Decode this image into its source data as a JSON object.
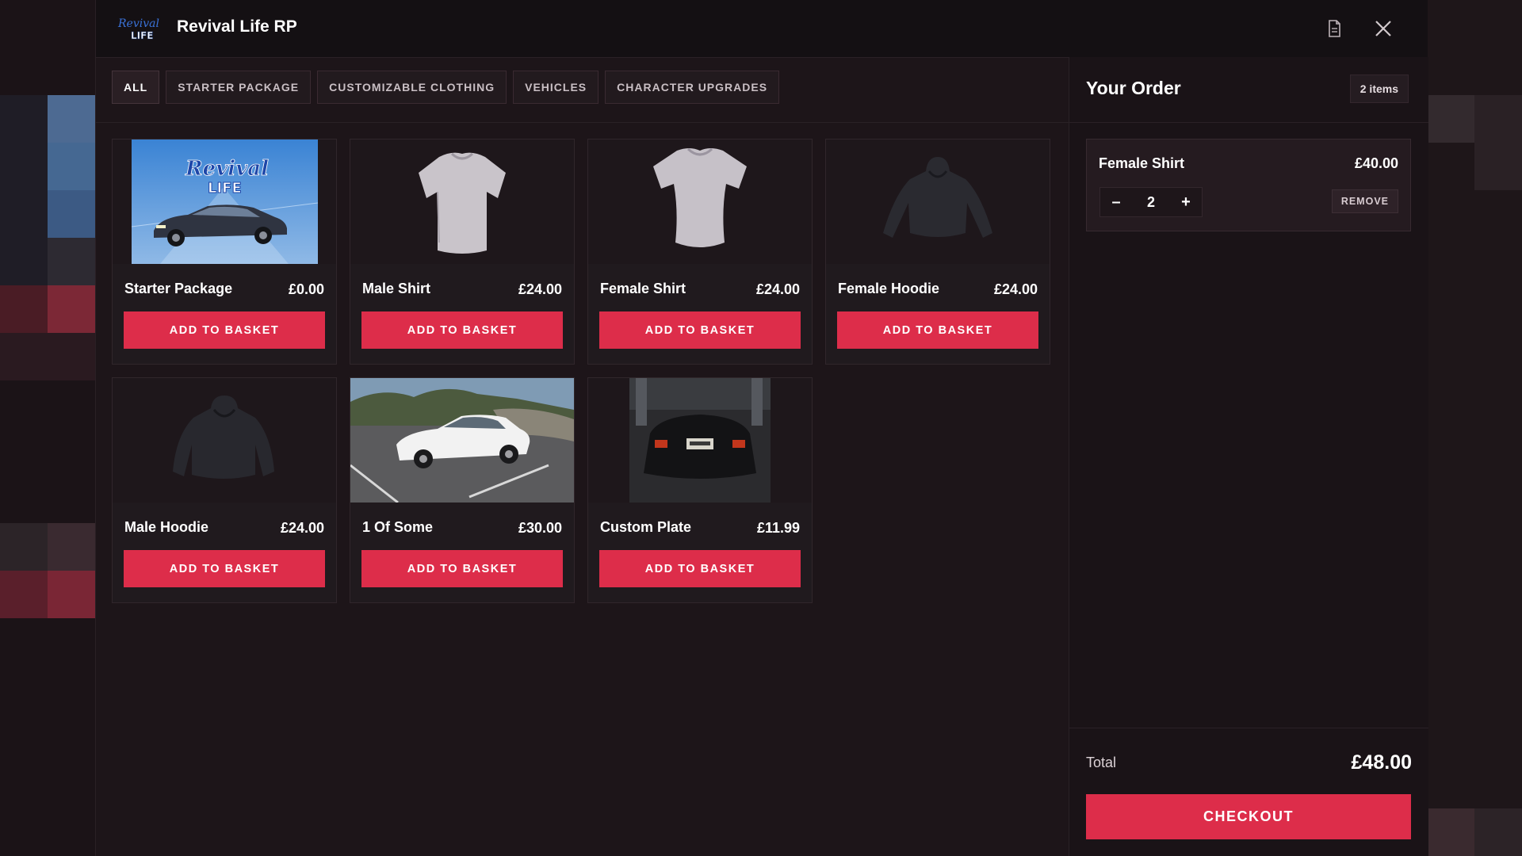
{
  "app": {
    "title": "Revival Life RP"
  },
  "tabs": [
    {
      "label": "ALL",
      "active": true
    },
    {
      "label": "STARTER PACKAGE",
      "active": false
    },
    {
      "label": "CUSTOMIZABLE CLOTHING",
      "active": false
    },
    {
      "label": "VEHICLES",
      "active": false
    },
    {
      "label": "CHARACTER UPGRADES",
      "active": false
    }
  ],
  "products": [
    {
      "name": "Starter Package",
      "price": "£0.00",
      "button": "ADD TO BASKET",
      "image": "starter-package-image"
    },
    {
      "name": "Male Shirt",
      "price": "£24.00",
      "button": "ADD TO BASKET",
      "image": "shirt-image"
    },
    {
      "name": "Female Shirt",
      "price": "£24.00",
      "button": "ADD TO BASKET",
      "image": "shirt-image"
    },
    {
      "name": "Female Hoodie",
      "price": "£24.00",
      "button": "ADD TO BASKET",
      "image": "hoodie-image"
    },
    {
      "name": "Male Hoodie",
      "price": "£24.00",
      "button": "ADD TO BASKET",
      "image": "hoodie-image"
    },
    {
      "name": "1 Of Some",
      "price": "£30.00",
      "button": "ADD TO BASKET",
      "image": "white-car-image"
    },
    {
      "name": "Custom Plate",
      "price": "£11.99",
      "button": "ADD TO BASKET",
      "image": "car-rear-plate-image"
    }
  ],
  "order": {
    "title": "Your Order",
    "count_label": "2 items",
    "items": [
      {
        "name": "Female Shirt",
        "price": "£40.00",
        "quantity": "2",
        "minus": "–",
        "plus": "+",
        "remove_label": "REMOVE"
      }
    ],
    "total_label": "Total",
    "total_value": "£48.00",
    "checkout_label": "CHECKOUT"
  },
  "colors": {
    "accent": "#dd2d4a",
    "background": "#1d1519",
    "titlebar": "#141013"
  },
  "icons": {
    "document": "document-icon",
    "close": "close-icon"
  }
}
